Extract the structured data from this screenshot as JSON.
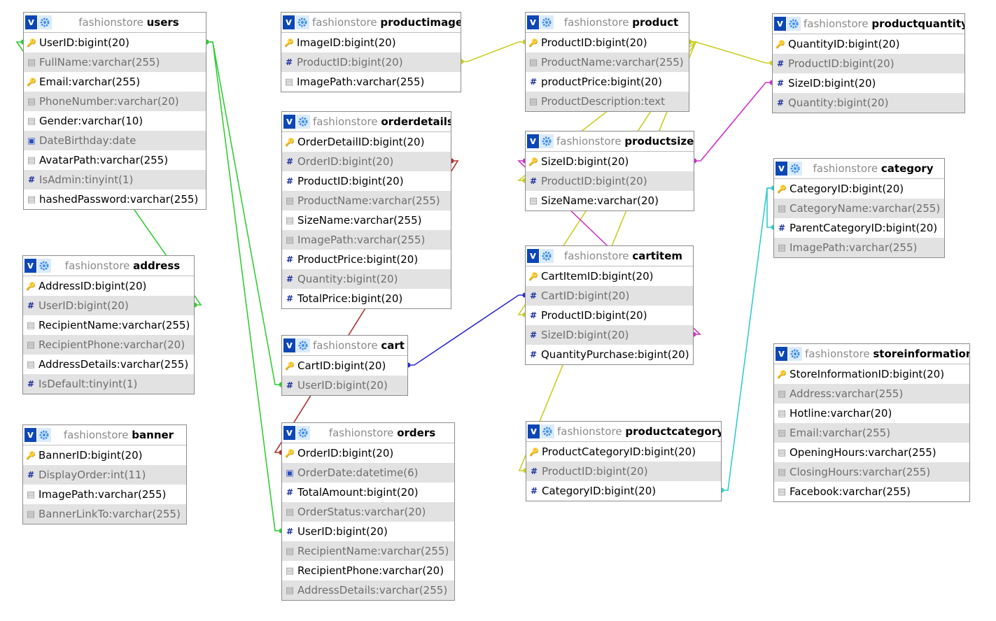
{
  "tables": [
    {
      "db": "fashionstore",
      "name": "users",
      "columns": [
        {
          "icon": "key-icon",
          "name": "UserID",
          "type": "bigint(20)"
        },
        {
          "icon": "text-icon",
          "name": "FullName",
          "type": "varchar(255)"
        },
        {
          "icon": "key-icon",
          "name": "Email",
          "type": "varchar(255)"
        },
        {
          "icon": "text-icon",
          "name": "PhoneNumber",
          "type": "varchar(20)"
        },
        {
          "icon": "text-icon",
          "name": "Gender",
          "type": "varchar(10)"
        },
        {
          "icon": "date-icon",
          "name": "DateBirthday",
          "type": "date"
        },
        {
          "icon": "text-icon",
          "name": "AvatarPath",
          "type": "varchar(255)"
        },
        {
          "icon": "number-icon",
          "name": "IsAdmin",
          "type": "tinyint(1)"
        },
        {
          "icon": "text-icon",
          "name": "hashedPassword",
          "type": "varchar(255)"
        }
      ]
    },
    {
      "db": "fashionstore",
      "name": "address",
      "columns": [
        {
          "icon": "key-icon",
          "name": "AddressID",
          "type": "bigint(20)"
        },
        {
          "icon": "number-icon",
          "name": "UserID",
          "type": "bigint(20)"
        },
        {
          "icon": "text-icon",
          "name": "RecipientName",
          "type": "varchar(255)"
        },
        {
          "icon": "text-icon",
          "name": "RecipientPhone",
          "type": "varchar(20)"
        },
        {
          "icon": "text-icon",
          "name": "AddressDetails",
          "type": "varchar(255)"
        },
        {
          "icon": "number-icon",
          "name": "IsDefault",
          "type": "tinyint(1)"
        }
      ]
    },
    {
      "db": "fashionstore",
      "name": "banner",
      "columns": [
        {
          "icon": "key-icon",
          "name": "BannerID",
          "type": "bigint(20)"
        },
        {
          "icon": "number-icon",
          "name": "DisplayOrder",
          "type": "int(11)"
        },
        {
          "icon": "text-icon",
          "name": "ImagePath",
          "type": "varchar(255)"
        },
        {
          "icon": "text-icon",
          "name": "BannerLinkTo",
          "type": "varchar(255)"
        }
      ]
    },
    {
      "db": "fashionstore",
      "name": "productimage",
      "columns": [
        {
          "icon": "key-icon",
          "name": "ImageID",
          "type": "bigint(20)"
        },
        {
          "icon": "number-icon",
          "name": "ProductID",
          "type": "bigint(20)"
        },
        {
          "icon": "text-icon",
          "name": "ImagePath",
          "type": "varchar(255)"
        }
      ]
    },
    {
      "db": "fashionstore",
      "name": "orderdetails",
      "columns": [
        {
          "icon": "key-icon",
          "name": "OrderDetailID",
          "type": "bigint(20)"
        },
        {
          "icon": "number-icon",
          "name": "OrderID",
          "type": "bigint(20)"
        },
        {
          "icon": "number-icon",
          "name": "ProductID",
          "type": "bigint(20)"
        },
        {
          "icon": "text-icon",
          "name": "ProductName",
          "type": "varchar(255)"
        },
        {
          "icon": "text-icon",
          "name": "SizeName",
          "type": "varchar(255)"
        },
        {
          "icon": "text-icon",
          "name": "ImagePath",
          "type": "varchar(255)"
        },
        {
          "icon": "number-icon",
          "name": "ProductPrice",
          "type": "bigint(20)"
        },
        {
          "icon": "number-icon",
          "name": "Quantity",
          "type": "bigint(20)"
        },
        {
          "icon": "number-icon",
          "name": "TotalPrice",
          "type": "bigint(20)"
        }
      ]
    },
    {
      "db": "fashionstore",
      "name": "cart",
      "columns": [
        {
          "icon": "key-icon",
          "name": "CartID",
          "type": "bigint(20)"
        },
        {
          "icon": "number-icon",
          "name": "UserID",
          "type": "bigint(20)"
        }
      ]
    },
    {
      "db": "fashionstore",
      "name": "orders",
      "columns": [
        {
          "icon": "key-icon",
          "name": "OrderID",
          "type": "bigint(20)"
        },
        {
          "icon": "date-icon",
          "name": "OrderDate",
          "type": "datetime(6)"
        },
        {
          "icon": "number-icon",
          "name": "TotalAmount",
          "type": "bigint(20)"
        },
        {
          "icon": "text-icon",
          "name": "OrderStatus",
          "type": "varchar(20)"
        },
        {
          "icon": "number-icon",
          "name": "UserID",
          "type": "bigint(20)"
        },
        {
          "icon": "text-icon",
          "name": "RecipientName",
          "type": "varchar(255)"
        },
        {
          "icon": "text-icon",
          "name": "RecipientPhone",
          "type": "varchar(20)"
        },
        {
          "icon": "text-icon",
          "name": "AddressDetails",
          "type": "varchar(255)"
        }
      ]
    },
    {
      "db": "fashionstore",
      "name": "product",
      "columns": [
        {
          "icon": "key-icon",
          "name": "ProductID",
          "type": "bigint(20)"
        },
        {
          "icon": "text-icon",
          "name": "ProductName",
          "type": "varchar(255)"
        },
        {
          "icon": "number-icon",
          "name": "productPrice",
          "type": "bigint(20)"
        },
        {
          "icon": "text-icon",
          "name": "ProductDescription",
          "type": "text"
        }
      ]
    },
    {
      "db": "fashionstore",
      "name": "productsize",
      "columns": [
        {
          "icon": "key-icon",
          "name": "SizeID",
          "type": "bigint(20)"
        },
        {
          "icon": "number-icon",
          "name": "ProductID",
          "type": "bigint(20)"
        },
        {
          "icon": "text-icon",
          "name": "SizeName",
          "type": "varchar(20)"
        }
      ]
    },
    {
      "db": "fashionstore",
      "name": "cartitem",
      "columns": [
        {
          "icon": "key-icon",
          "name": "CartItemID",
          "type": "bigint(20)"
        },
        {
          "icon": "number-icon",
          "name": "CartID",
          "type": "bigint(20)"
        },
        {
          "icon": "number-icon",
          "name": "ProductID",
          "type": "bigint(20)"
        },
        {
          "icon": "number-icon",
          "name": "SizeID",
          "type": "bigint(20)"
        },
        {
          "icon": "number-icon",
          "name": "QuantityPurchase",
          "type": "bigint(20)"
        }
      ]
    },
    {
      "db": "fashionstore",
      "name": "productcategory",
      "columns": [
        {
          "icon": "key-icon",
          "name": "ProductCategoryID",
          "type": "bigint(20)"
        },
        {
          "icon": "number-icon",
          "name": "ProductID",
          "type": "bigint(20)"
        },
        {
          "icon": "number-icon",
          "name": "CategoryID",
          "type": "bigint(20)"
        }
      ]
    },
    {
      "db": "fashionstore",
      "name": "productquantity",
      "columns": [
        {
          "icon": "key-icon",
          "name": "QuantityID",
          "type": "bigint(20)"
        },
        {
          "icon": "number-icon",
          "name": "ProductID",
          "type": "bigint(20)"
        },
        {
          "icon": "number-icon",
          "name": "SizeID",
          "type": "bigint(20)"
        },
        {
          "icon": "number-icon",
          "name": "Quantity",
          "type": "bigint(20)"
        }
      ]
    },
    {
      "db": "fashionstore",
      "name": "category",
      "columns": [
        {
          "icon": "key-icon",
          "name": "CategoryID",
          "type": "bigint(20)"
        },
        {
          "icon": "text-icon",
          "name": "CategoryName",
          "type": "varchar(255)"
        },
        {
          "icon": "number-icon",
          "name": "ParentCategoryID",
          "type": "bigint(20)"
        },
        {
          "icon": "text-icon",
          "name": "ImagePath",
          "type": "varchar(255)"
        }
      ]
    },
    {
      "db": "fashionstore",
      "name": "storeinformation",
      "columns": [
        {
          "icon": "key-icon",
          "name": "StoreInformationID",
          "type": "bigint(20)"
        },
        {
          "icon": "text-icon",
          "name": "Address",
          "type": "varchar(255)"
        },
        {
          "icon": "text-icon",
          "name": "Hotline",
          "type": "varchar(20)"
        },
        {
          "icon": "text-icon",
          "name": "Email",
          "type": "varchar(255)"
        },
        {
          "icon": "text-icon",
          "name": "OpeningHours",
          "type": "varchar(255)"
        },
        {
          "icon": "text-icon",
          "name": "ClosingHours",
          "type": "varchar(255)"
        },
        {
          "icon": "text-icon",
          "name": "Facebook",
          "type": "varchar(255)"
        }
      ]
    }
  ],
  "relations": [
    {
      "from": "users.UserID",
      "to": "address.UserID",
      "color": "#33cc33"
    },
    {
      "from": "users.UserID",
      "to": "cart.UserID",
      "color": "#33cc33"
    },
    {
      "from": "users.UserID",
      "to": "orders.UserID",
      "color": "#33cc33"
    },
    {
      "from": "orders.OrderID",
      "to": "orderdetails.OrderID",
      "color": "#b03030"
    },
    {
      "from": "product.ProductID",
      "to": "productimage.ProductID",
      "color": "#cccc22"
    },
    {
      "from": "product.ProductID",
      "to": "productsize.ProductID",
      "color": "#cccc22"
    },
    {
      "from": "product.ProductID",
      "to": "cartitem.ProductID",
      "color": "#cccc22"
    },
    {
      "from": "product.ProductID",
      "to": "productcategory.ProductID",
      "color": "#cccc22"
    },
    {
      "from": "product.ProductID",
      "to": "productquantity.ProductID",
      "color": "#cccc22"
    },
    {
      "from": "cart.CartID",
      "to": "cartitem.CartID",
      "color": "#2b2bcc"
    },
    {
      "from": "productsize.SizeID",
      "to": "cartitem.SizeID",
      "color": "#cc33cc"
    },
    {
      "from": "productsize.SizeID",
      "to": "productquantity.SizeID",
      "color": "#cc33cc"
    },
    {
      "from": "category.CategoryID",
      "to": "productcategory.CategoryID",
      "color": "#33cccc"
    },
    {
      "from": "category.CategoryID",
      "to": "category.ParentCategoryID",
      "color": "#33cccc"
    }
  ],
  "colors": {
    "header_button": "#0d47b5",
    "gear_bg": "#dcebfb",
    "alt_row": "#e2e2e2",
    "border": "#8c8c8c"
  }
}
